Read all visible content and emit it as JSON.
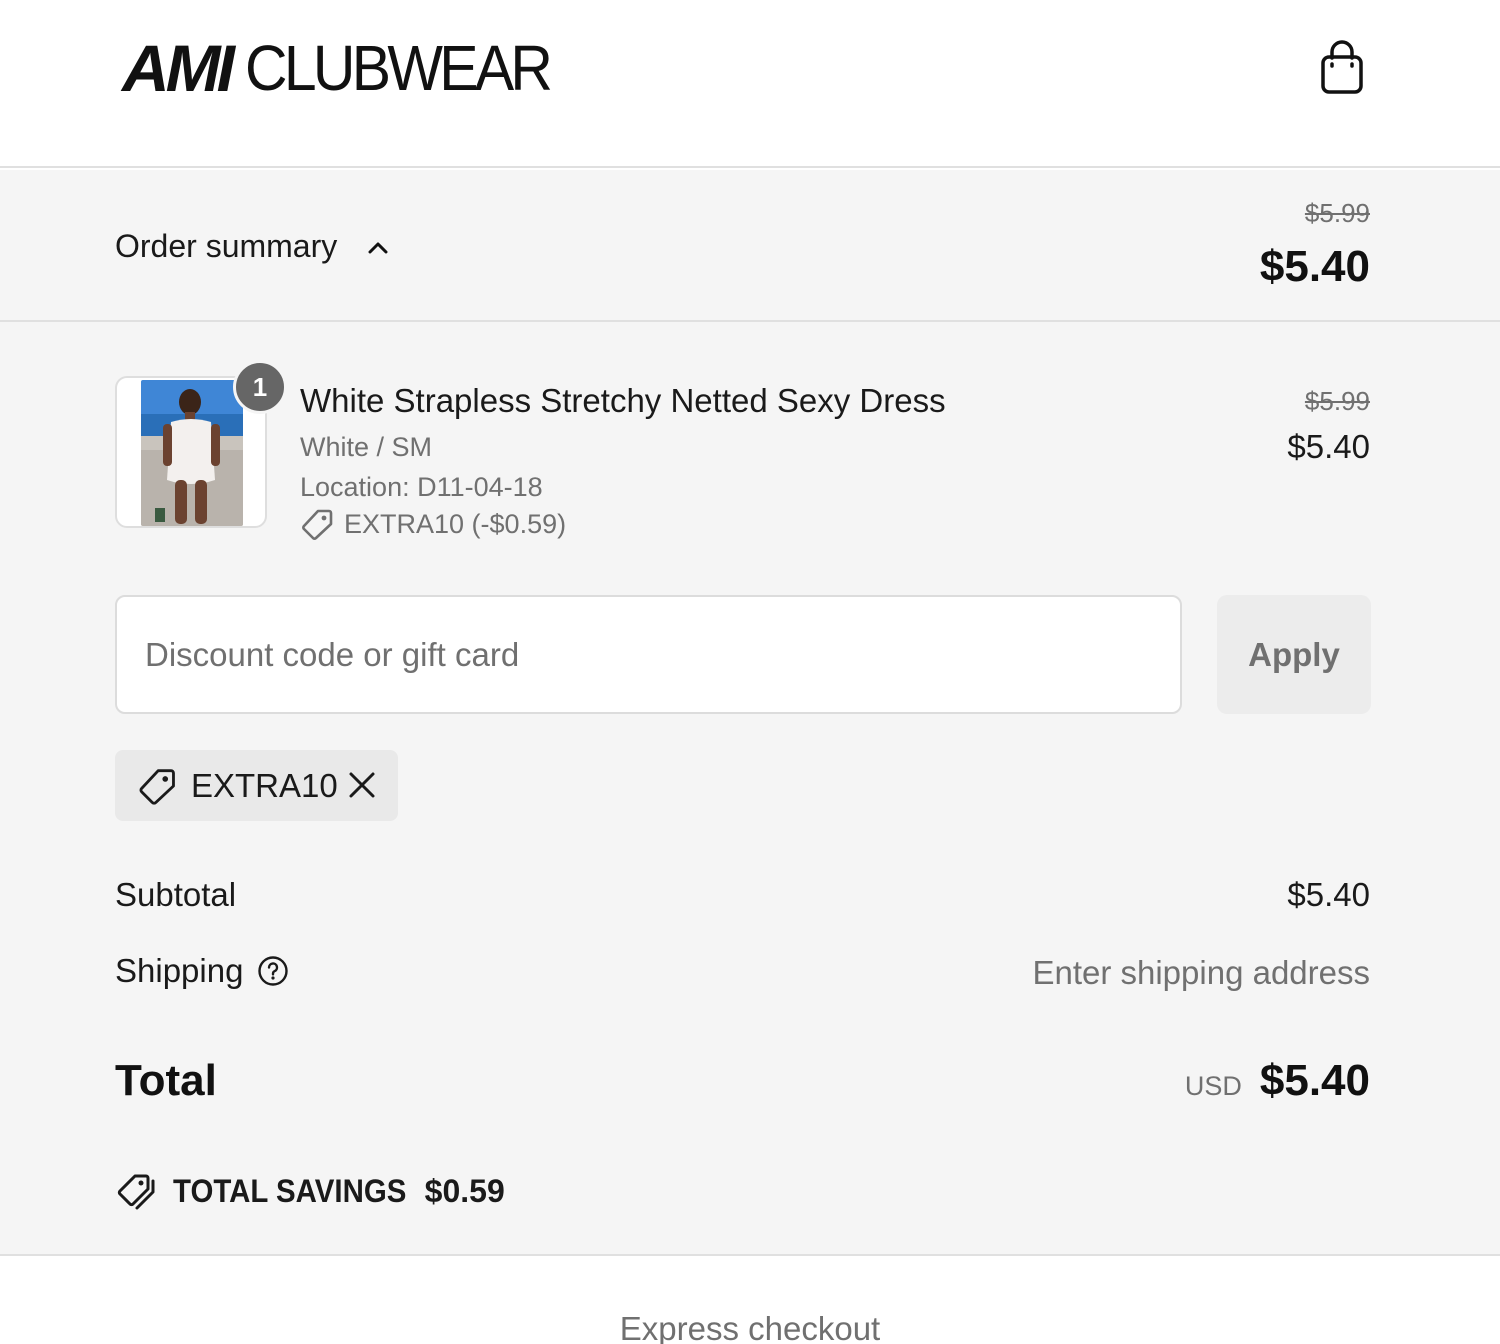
{
  "brand": {
    "logo_bold": "AMI",
    "logo_light": "CLUBWEAR"
  },
  "header": {
    "cart_icon": "shopping-bag-icon"
  },
  "summary": {
    "toggle_label": "Order summary",
    "toggle_icon": "chevron-up-icon",
    "compare_total": "$5.99",
    "total": "$5.40"
  },
  "line_items": [
    {
      "quantity": "1",
      "title": "White Strapless Stretchy Netted Sexy Dress",
      "variant": "White / SM",
      "location": "Location: D11-04-18",
      "discount": "EXTRA10 (-$0.59)",
      "compare_price": "$5.99",
      "price": "$5.40"
    }
  ],
  "discount": {
    "placeholder": "Discount code or gift card",
    "value": "",
    "apply_label": "Apply",
    "applied_code": "EXTRA10"
  },
  "totals": {
    "subtotal_label": "Subtotal",
    "subtotal_value": "$5.40",
    "shipping_label": "Shipping",
    "shipping_value": "Enter shipping address",
    "total_label": "Total",
    "currency": "USD",
    "total_value": "$5.40",
    "savings_label": "TOTAL SAVINGS",
    "savings_value": "$0.59"
  },
  "express": {
    "label": "Express checkout"
  },
  "colors": {
    "panel_bg": "#f5f5f5",
    "muted_text": "#707070",
    "badge_bg": "#666666",
    "chip_bg": "#e9e9e9"
  }
}
